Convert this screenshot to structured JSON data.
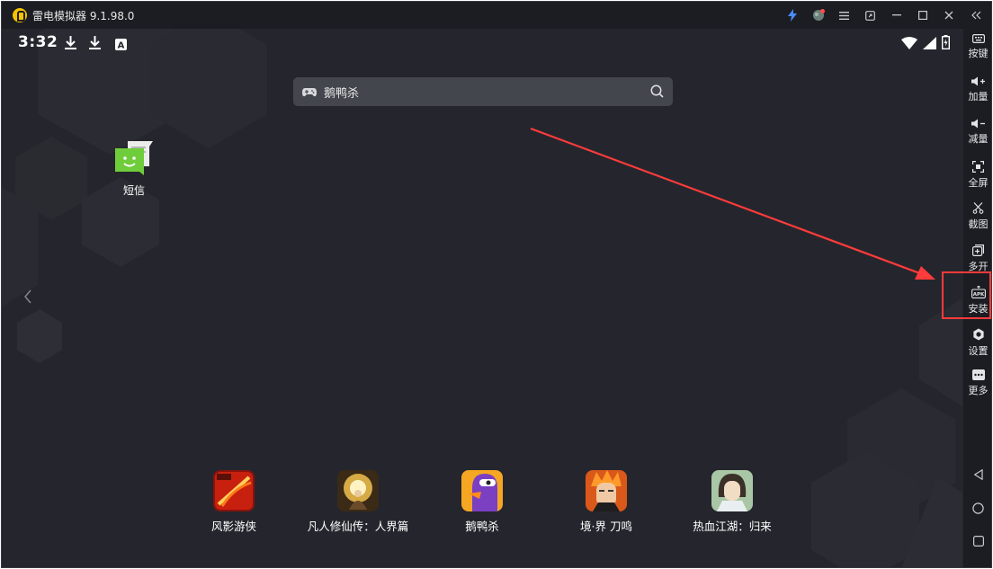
{
  "window": {
    "title": "雷电模拟器 9.1.98.0",
    "controls": [
      "lightning-icon",
      "skin-icon",
      "menu-icon",
      "restore-window-icon",
      "minimize-icon",
      "maximize-icon",
      "close-icon",
      "collapse-sidebar-icon"
    ]
  },
  "statusbar": {
    "time": "3:32",
    "icons": [
      "download-icon",
      "download-icon",
      "keyboard-a-icon",
      "wifi-icon",
      "signal-icon",
      "battery-icon"
    ]
  },
  "search": {
    "text": "鹅鸭杀"
  },
  "desktop": {
    "apps": [
      {
        "label": "短信",
        "icon": "sms-icon"
      }
    ]
  },
  "dock": {
    "apps": [
      {
        "label": "风影游侠",
        "icon": "fengying-game-icon"
      },
      {
        "label": "凡人修仙传：人界篇",
        "icon": "fanren-game-icon"
      },
      {
        "label": "鹅鸭杀",
        "icon": "goose-goose-duck-icon"
      },
      {
        "label": "境·界 刀鸣",
        "icon": "bleach-game-icon"
      },
      {
        "label": "热血江湖：归来",
        "icon": "rexue-game-icon"
      }
    ]
  },
  "toolbar": {
    "items": [
      {
        "label": "按键",
        "icon": "keymap-icon"
      },
      {
        "label": "加量",
        "icon": "volume-up-icon"
      },
      {
        "label": "减量",
        "icon": "volume-down-icon"
      },
      {
        "label": "全屏",
        "icon": "fullscreen-icon"
      },
      {
        "label": "截图",
        "icon": "scissors-icon"
      },
      {
        "label": "多开",
        "icon": "multi-instance-icon"
      },
      {
        "label": "安装",
        "icon": "apk-install-icon"
      },
      {
        "label": "设置",
        "icon": "settings-icon"
      },
      {
        "label": "更多",
        "icon": "more-icon"
      }
    ],
    "nav": [
      "back-icon",
      "home-icon",
      "recents-icon"
    ]
  },
  "colors": {
    "titlebar": "#1c1d22",
    "screen": "#25262d",
    "annotation": "#ff3b3b",
    "logo": "#f7c300"
  }
}
